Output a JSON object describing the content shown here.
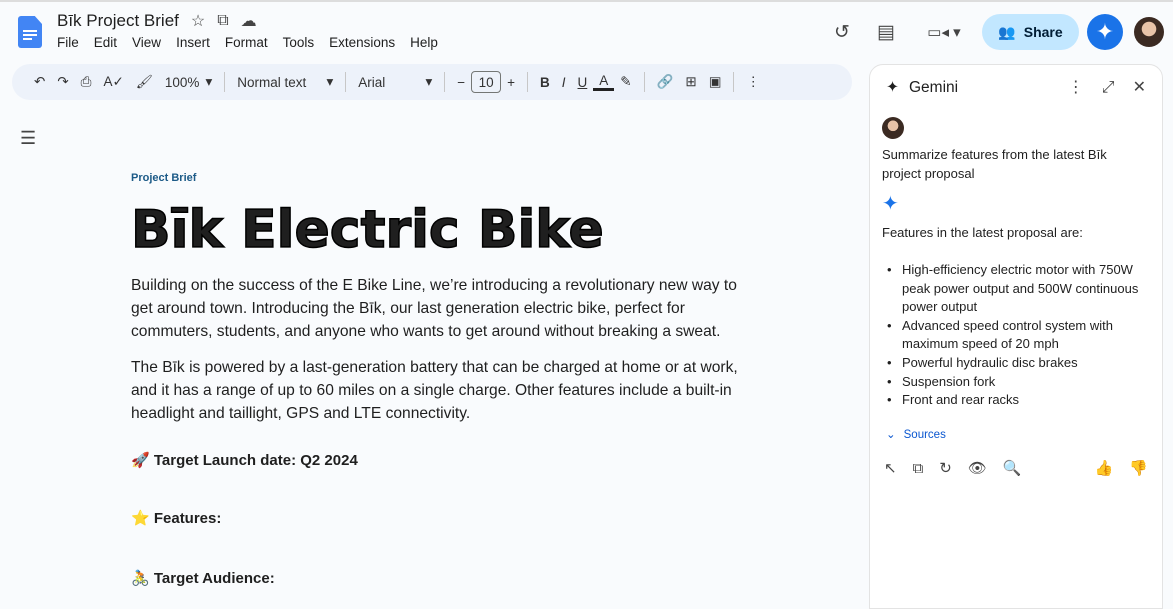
{
  "header": {
    "doc_title": "Bīk Project Brief",
    "menu": [
      "File",
      "Edit",
      "View",
      "Insert",
      "Format",
      "Tools",
      "Extensions",
      "Help"
    ],
    "share_label": "Share"
  },
  "toolbar": {
    "zoom": "100%",
    "style": "Normal text",
    "font": "Arial",
    "font_size": "10"
  },
  "document": {
    "kicker": "Project Brief",
    "title": "Bīk Electric Bike",
    "p1": "Building on the success of the E Bike Line, we’re introducing a revolutionary new way to get around town. Introducing the Bīk, our last generation electric bike, perfect for commuters, students, and anyone who wants to get around without breaking a sweat.",
    "p2": "The Bīk is powered by a last-generation battery that can be charged at home or at work, and it has a range of up to 60 miles on a single charge. Other features include a built-in headlight and taillight, GPS and LTE connectivity.",
    "h_launch": "🚀 Target Launch date: Q2 2024",
    "h_features": "⭐ Features:",
    "h_audience": "🚴 Target Audience:"
  },
  "gemini": {
    "title": "Gemini",
    "prompt": "Summarize features from the latest Bīk project proposal",
    "answer_intro": "Features in the latest proposal are:",
    "features": [
      "High-efficiency electric motor with 750W peak power output and 500W continuous power output",
      "Advanced speed control system with maximum speed of 20 mph",
      "Powerful hydraulic disc brakes",
      "Suspension fork",
      "Front and rear racks"
    ],
    "sources_label": "Sources"
  },
  "colors": {
    "accent": "#0b57d0",
    "share_bg": "#c2e7ff",
    "toolbar_bg": "#edf2fa"
  }
}
